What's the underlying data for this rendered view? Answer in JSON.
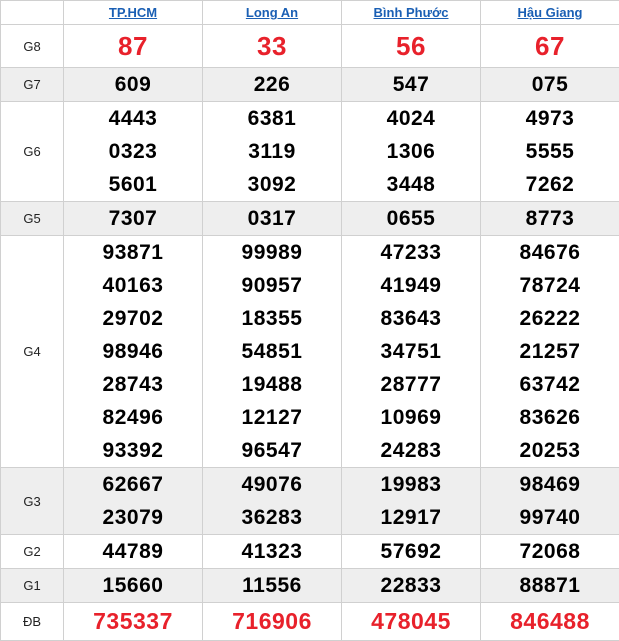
{
  "provinces": [
    "TP.HCM",
    "Long An",
    "Bình Phước",
    "Hậu Giang"
  ],
  "colors": {
    "header_link": "#1a5fb4",
    "highlight": "#e8212b",
    "shade": "#eeeeee"
  },
  "rows": [
    {
      "label": "G8",
      "numbers": [
        [
          "87"
        ],
        [
          "33"
        ],
        [
          "56"
        ],
        [
          "67"
        ]
      ]
    },
    {
      "label": "G7",
      "numbers": [
        [
          "609"
        ],
        [
          "226"
        ],
        [
          "547"
        ],
        [
          "075"
        ]
      ]
    },
    {
      "label": "G6",
      "numbers": [
        [
          "4443",
          "0323",
          "5601"
        ],
        [
          "6381",
          "3119",
          "3092"
        ],
        [
          "4024",
          "1306",
          "3448"
        ],
        [
          "4973",
          "5555",
          "7262"
        ]
      ]
    },
    {
      "label": "G5",
      "numbers": [
        [
          "7307"
        ],
        [
          "0317"
        ],
        [
          "0655"
        ],
        [
          "8773"
        ]
      ]
    },
    {
      "label": "G4",
      "numbers": [
        [
          "93871",
          "40163",
          "29702",
          "98946",
          "28743",
          "82496",
          "93392"
        ],
        [
          "99989",
          "90957",
          "18355",
          "54851",
          "19488",
          "12127",
          "96547"
        ],
        [
          "47233",
          "41949",
          "83643",
          "34751",
          "28777",
          "10969",
          "24283"
        ],
        [
          "84676",
          "78724",
          "26222",
          "21257",
          "63742",
          "83626",
          "20253"
        ]
      ]
    },
    {
      "label": "G3",
      "numbers": [
        [
          "62667",
          "23079"
        ],
        [
          "49076",
          "36283"
        ],
        [
          "19983",
          "12917"
        ],
        [
          "98469",
          "99740"
        ]
      ]
    },
    {
      "label": "G2",
      "numbers": [
        [
          "44789"
        ],
        [
          "41323"
        ],
        [
          "57692"
        ],
        [
          "72068"
        ]
      ]
    },
    {
      "label": "G1",
      "numbers": [
        [
          "15660"
        ],
        [
          "11556"
        ],
        [
          "22833"
        ],
        [
          "88871"
        ]
      ]
    },
    {
      "label": "ĐB",
      "numbers": [
        [
          "735337"
        ],
        [
          "716906"
        ],
        [
          "478045"
        ],
        [
          "846488"
        ]
      ]
    }
  ]
}
